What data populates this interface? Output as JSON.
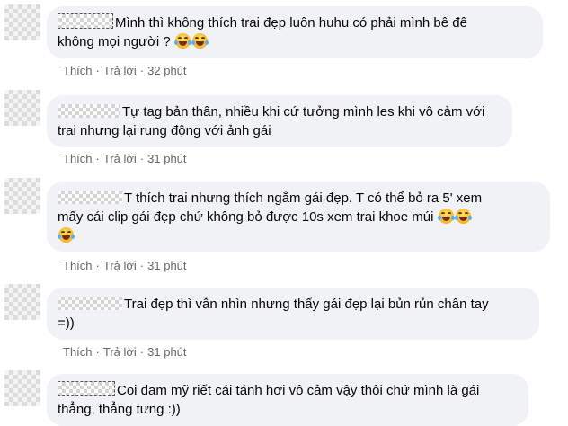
{
  "actions": {
    "like_label": "Thích",
    "reply_label": "Trả lời",
    "separator": "·"
  },
  "comments": [
    {
      "text_line1": "Mình thì không thích trai đẹp luôn huhu có phải mình bê đê",
      "text_line2": "không mọi người ?",
      "emoji": [
        "rofl-emoji",
        "rofl-emoji"
      ],
      "time": "32 phút"
    },
    {
      "text_line1": "Tự tag bản thân, nhiều khi cứ tưởng mình les khi vô cảm với",
      "text_line2": "trai nhưng lại rung động với ảnh gái",
      "emoji": [],
      "time": "31 phút"
    },
    {
      "text_line1": "T thích trai nhưng thích ngắm gái đẹp. T có thể bỏ ra 5' xem",
      "text_line2": "mấy cái clip gái đẹp chứ không bỏ được 10s xem trai khoe múi",
      "emoji": [
        "grin-sweat-emoji",
        "grin-sweat-emoji",
        "grin-sweat-emoji"
      ],
      "time": "31 phút"
    },
    {
      "text_line1": "Trai đẹp thì vẫn nhìn nhưng thấy gái đẹp lại bủn rủn chân tay",
      "text_line2": "=))",
      "emoji": [],
      "time": "31 phút"
    },
    {
      "text_line1": "Coi đam mỹ riết cái tánh hơi vô cảm vậy thôi chứ mình là gái",
      "text_line2": "thẳng, thẳng tưng :))",
      "emoji": [],
      "time": ""
    }
  ]
}
